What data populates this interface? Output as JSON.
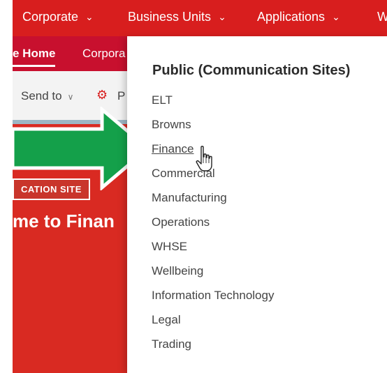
{
  "topnav": {
    "items": [
      {
        "label": "Corporate"
      },
      {
        "label": "Business Units"
      },
      {
        "label": "Applications"
      },
      {
        "label": "W"
      }
    ]
  },
  "subnav": {
    "home_label": "e Home",
    "corporate_label": "Corpora"
  },
  "commandbar": {
    "send_to_label": "Send to",
    "page_label": "P"
  },
  "hero": {
    "badge": "CATION SITE",
    "title": "me to Finan"
  },
  "dropdown": {
    "title": "Public (Communication Sites)",
    "items": [
      {
        "label": "ELT"
      },
      {
        "label": "Browns"
      },
      {
        "label": "Finance"
      },
      {
        "label": "Commercial"
      },
      {
        "label": "Manufacturing"
      },
      {
        "label": "Operations"
      },
      {
        "label": "WHSE"
      },
      {
        "label": "Wellbeing"
      },
      {
        "label": "Information Technology"
      },
      {
        "label": "Legal"
      },
      {
        "label": "Trading"
      }
    ],
    "hovered_item": "Finance"
  },
  "icons": {
    "chevron": "chevron-down-icon",
    "gear": "gear-icon",
    "arrow": "green-arrow-icon",
    "cursor": "hand-pointer-icon"
  },
  "colors": {
    "brand_red": "#d81e1e",
    "secondary_red": "#c8102e",
    "hero_red": "#d92a22",
    "arrow_green": "#14a04a"
  }
}
